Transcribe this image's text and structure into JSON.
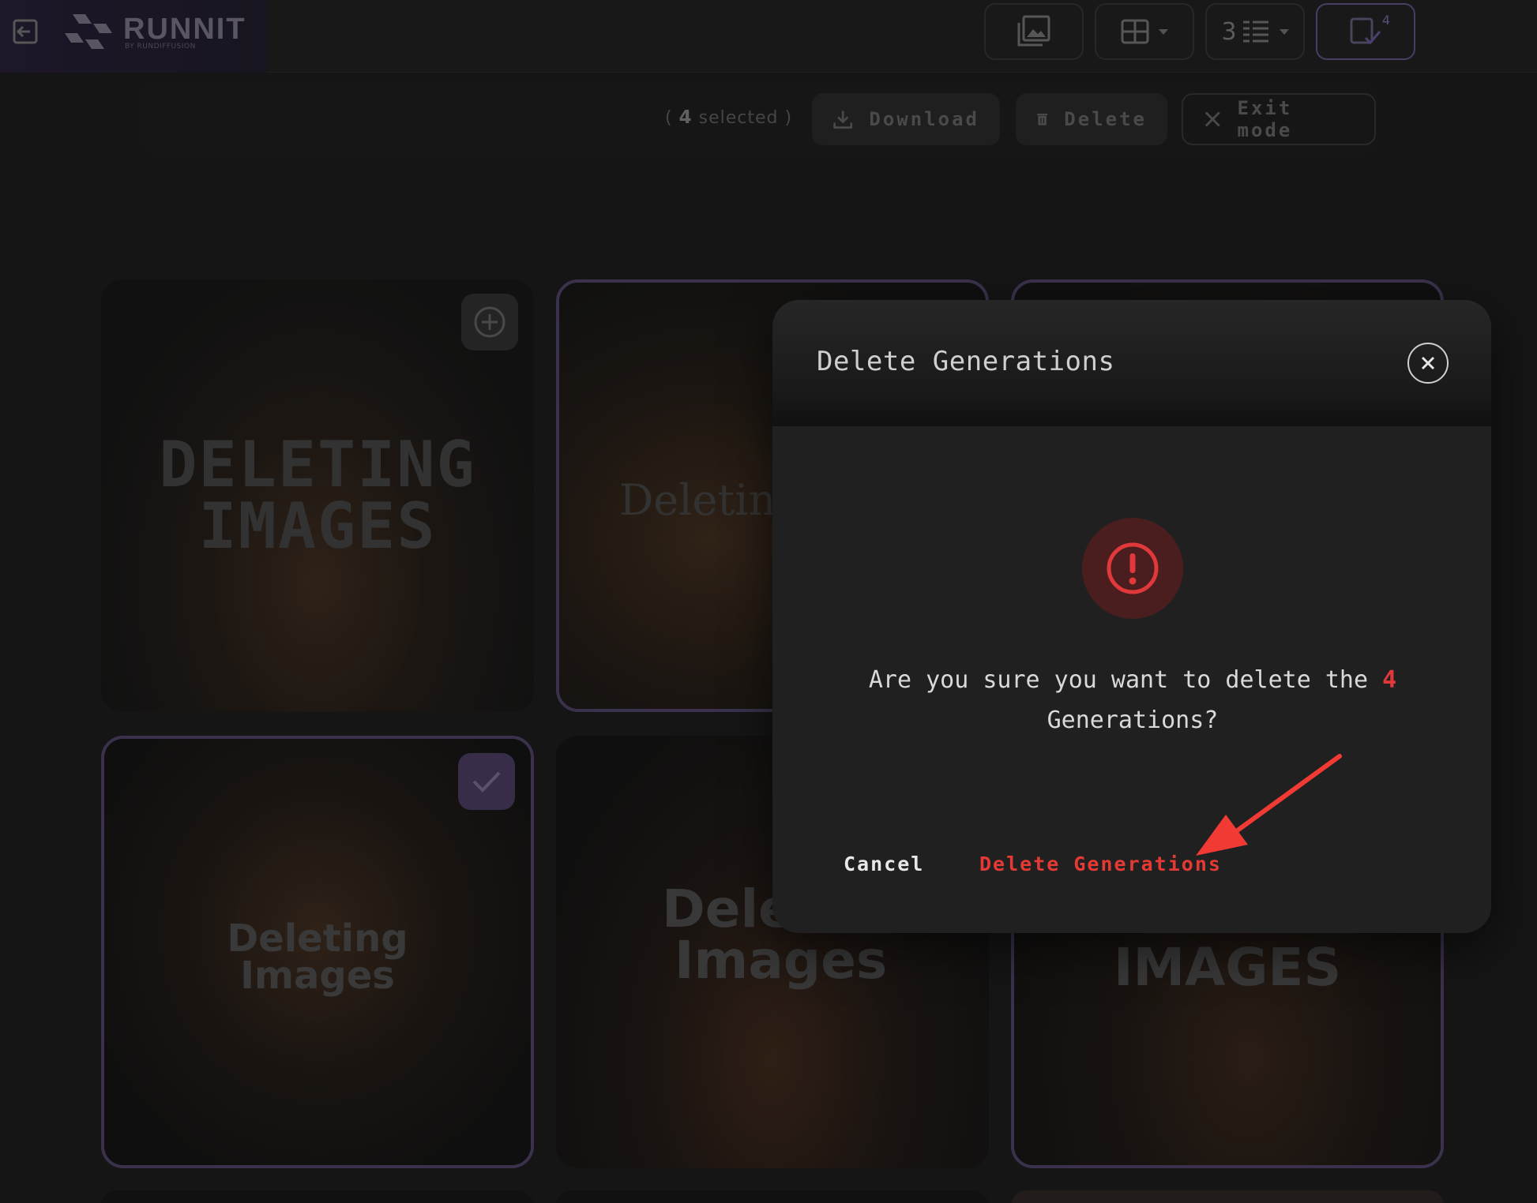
{
  "app": {
    "brand_name": "RUNNIT",
    "brand_sub": "BY RUNDIFFUSION"
  },
  "toolbar": {
    "columns_count": "3",
    "selected_badge": "4"
  },
  "selection_bar": {
    "count": "4",
    "count_suffix": "selected",
    "open_paren": "(",
    "close_paren": ")",
    "download_label": "Download",
    "delete_label": "Delete",
    "exit_label": "Exit mode"
  },
  "cards": [
    {
      "title_line1": "DELETING",
      "title_line2": "IMAGES",
      "selected": false
    },
    {
      "title_line1": "Deleting",
      "title_line2": "",
      "selected": true
    },
    {
      "title_line1": "",
      "title_line2": "",
      "selected": true
    },
    {
      "title_line1": "Deleting",
      "title_line2": "Images",
      "selected": true
    },
    {
      "title_line1": "Dele",
      "title_line2": "Images",
      "selected": false
    },
    {
      "title_line1": "",
      "title_line2": "IMAGES",
      "selected": true
    }
  ],
  "modal": {
    "title": "Delete Generations",
    "message_before": "Are you sure you want to delete the",
    "message_count": "4",
    "message_after": "Generations?",
    "cancel_label": "Cancel",
    "confirm_label": "Delete Generations"
  },
  "colors": {
    "danger": "#e53935",
    "accent": "#5a4b7a"
  }
}
